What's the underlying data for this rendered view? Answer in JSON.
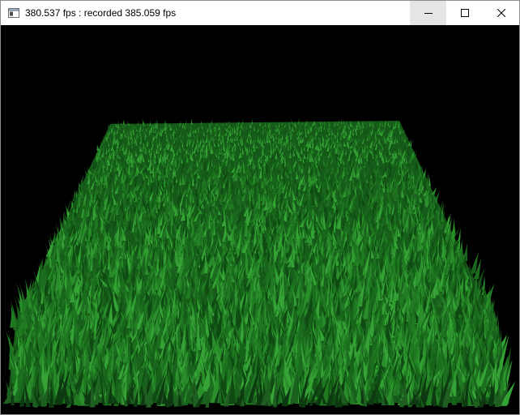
{
  "window": {
    "title": "380.537 fps : recorded 385.059 fps"
  },
  "controls": {
    "minimize_icon": "minimize-icon",
    "maximize_icon": "maximize-icon",
    "close_icon": "close-icon"
  },
  "scene": {
    "background": "#000000",
    "grass_colors": [
      "#0f4a12",
      "#18631b",
      "#207a22",
      "#2a8f2b",
      "#35a335",
      "#1c6e1f"
    ]
  }
}
